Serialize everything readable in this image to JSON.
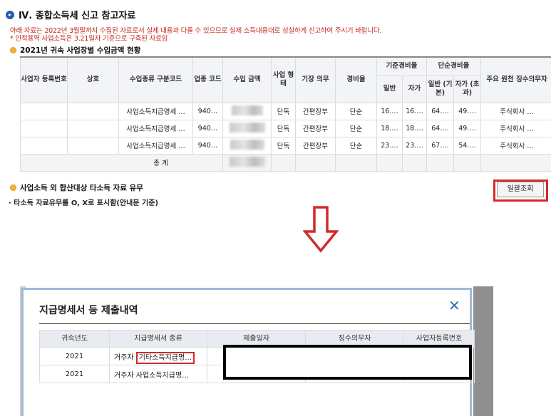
{
  "section": {
    "title": "Ⅳ. 종합소득세 신고 참고자료",
    "icon_label": "▸",
    "notice1": "아래 자료는 2022년 3월말까지 수집된 자료로서 실제 내용과 다를 수 있으므로 실제 소득내용대로 성실하게 신고하여 주시기 바랍니다.",
    "notice2": "* 인적용역 사업소득은 3.21일자 기준으로 구축된 자료임"
  },
  "income_table": {
    "title": "2021년 귀속 사업장별 수입금액 현황",
    "headers": {
      "biz_no": "사업자 등록번호",
      "name": "상호",
      "type_code": "수입종류 구분코드",
      "industry_code": "업종 코드",
      "amount": "수입 금액",
      "biz_form": "사업 형태",
      "bookkeeping": "기장 의무",
      "expense_rate": "경비율",
      "std_rate": "기준경비율",
      "simple_rate": "단순경비율",
      "general": "일반",
      "self": "자가",
      "simple_general": "일반 (기본)",
      "simple_self": "자가 (초과)",
      "withholder": "주요 원천 징수의무자"
    },
    "rows": [
      {
        "biz_no": "",
        "name": "",
        "type_code": "사업소득지급명세 …",
        "industry_code": "940…",
        "biz_form": "단독",
        "bookkeeping": "간편장부",
        "expense_rate": "단순",
        "std_general": "16.…",
        "std_self": "16.…",
        "simple_general": "64.…",
        "simple_self": "49.…",
        "withholder": "주식회사 …"
      },
      {
        "biz_no": "",
        "name": "",
        "type_code": "사업소득지급명세 …",
        "industry_code": "940…",
        "biz_form": "단독",
        "bookkeeping": "간편장부",
        "expense_rate": "단순",
        "std_general": "18.…",
        "std_self": "18.…",
        "simple_general": "64.…",
        "simple_self": "49.…",
        "withholder": "주식회사 …"
      },
      {
        "biz_no": "",
        "name": "",
        "type_code": "사업소득지급명세 …",
        "industry_code": "940…",
        "biz_form": "단독",
        "bookkeeping": "간편장부",
        "expense_rate": "단순",
        "std_general": "23.…",
        "std_self": "23.…",
        "simple_general": "67.…",
        "simple_self": "54.…",
        "withholder": "주식회사 …"
      }
    ],
    "total_label": "총  계"
  },
  "other_income": {
    "title": "사업소득 외 합산대상 타소득 자료 유무",
    "note": "· 타소득 자료유무를 O, X로 표시함(안내문 기준)",
    "bulk_button": "일괄조회"
  },
  "arrow": {
    "icon": "down-arrow-icon",
    "color": "#d22a2a"
  },
  "modal": {
    "title": "지급명세서 등 제출내역",
    "close_glyph": "✕",
    "headers": [
      "귀속년도",
      "지급명세서 종류",
      "제출일자",
      "징수의무자",
      "사업자등록번호"
    ],
    "rows": [
      {
        "year": "2021",
        "kind_prefix": "거주자 ",
        "kind_highlight": "기타소득지급명…",
        "kind": ""
      },
      {
        "year": "2021",
        "kind_prefix": "거주자 ",
        "kind_highlight": "",
        "kind": "사업소득지급명…"
      }
    ]
  },
  "colors": {
    "accent_red": "#d22a2a",
    "notice_red": "#c4281c",
    "modal_border": "#9fb9d7",
    "link_blue": "#2e6fb7"
  }
}
